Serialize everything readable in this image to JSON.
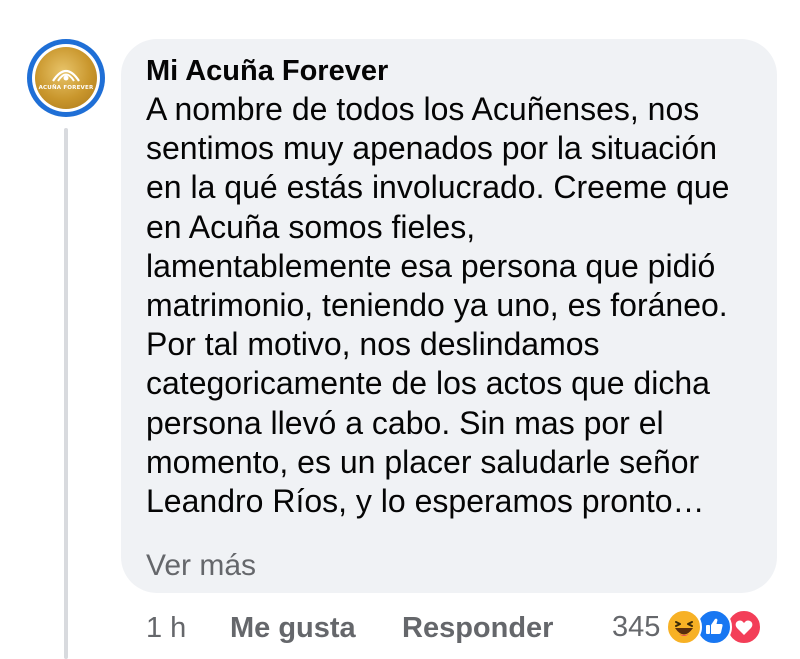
{
  "comment": {
    "author": "Mi Acuña Forever",
    "avatar_text": "ACUÑA FOREVER",
    "body_lines": [
      "A nombre de todos los Acuñenses, nos",
      "sentimos muy apenados por la situación",
      "en la qué estás involucrado. Creeme que",
      "en Acuña somos fieles,",
      "lamentablemente esa persona que pidió",
      "matrimonio, teniendo ya uno, es foráneo.",
      "Por tal motivo, nos deslindamos",
      "categoricamente de los actos que dicha",
      "persona llevó a cabo. Sin mas por el",
      "momento, es un placer saludarle señor",
      "Leandro Ríos,  y lo esperamos pronto…"
    ],
    "see_more": "Ver más",
    "timestamp": "1 h",
    "like_label": "Me gusta",
    "reply_label": "Responder",
    "reaction_count": "345",
    "reactions": [
      "haha-icon",
      "like-icon",
      "love-icon"
    ]
  },
  "colors": {
    "bubble_bg": "#f0f2f5",
    "text": "#050505",
    "secondary_text": "#65676b",
    "avatar_ring": "#1f6fd6",
    "haha": "#f7b125",
    "like": "#1877f2",
    "love": "#f33e58"
  }
}
